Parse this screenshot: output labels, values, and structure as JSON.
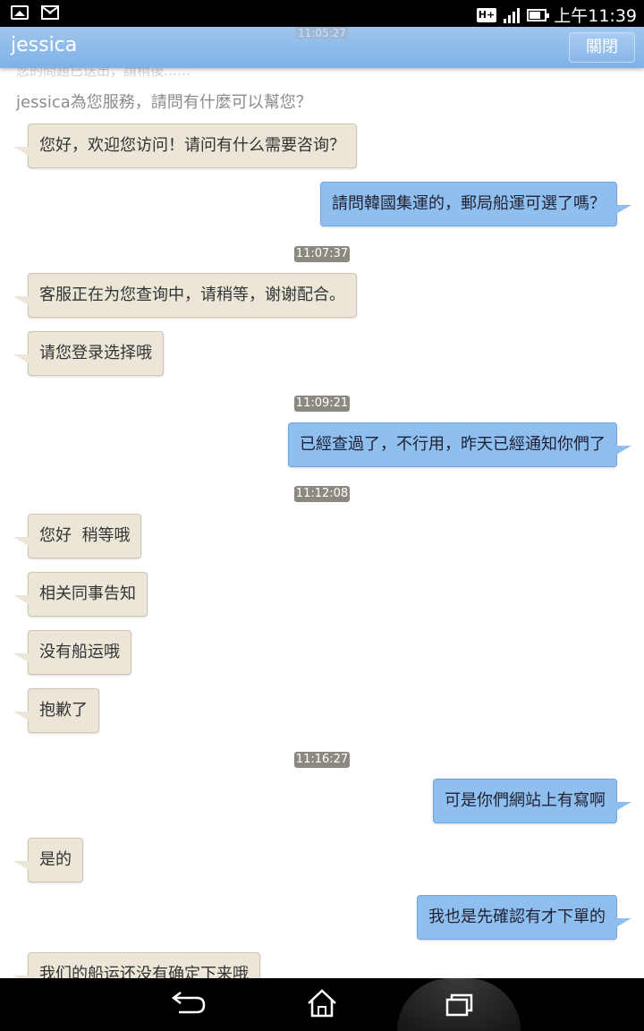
{
  "status_bar": {
    "time": "上午11:39",
    "icons": [
      "image-notification-icon",
      "mail-icon",
      "hplus-network-icon",
      "signal-icon",
      "battery-icon"
    ],
    "network_label": "H+"
  },
  "header": {
    "title": "jessica",
    "close_label": "關閉",
    "peek_time": "11:05:27",
    "color": "#8ab8ea"
  },
  "chat": {
    "peek_text": "您的問題已送出，請稍後……",
    "welcome": "jessica為您服務，請問有什麼可以幫您？",
    "messages": [
      {
        "side": "left",
        "text": "您好，欢迎您访问！请问有什么需要咨询？"
      },
      {
        "side": "right",
        "text": "請問韓國集運的，郵局船運可選了嗎？"
      },
      {
        "type": "time",
        "text": "11:07:37"
      },
      {
        "side": "left",
        "text": "客服正在为您查询中，请稍等，谢谢配合。"
      },
      {
        "side": "left",
        "text": "请您登录选择哦"
      },
      {
        "type": "time",
        "text": "11:09:21"
      },
      {
        "side": "right",
        "text": "已經查過了，不行用，昨天已經通知你們了"
      },
      {
        "type": "time",
        "text": "11:12:08"
      },
      {
        "side": "left",
        "text": "您好  稍等哦"
      },
      {
        "side": "left",
        "text": "相关同事告知"
      },
      {
        "side": "left",
        "text": "没有船运哦"
      },
      {
        "side": "left",
        "text": "抱歉了"
      },
      {
        "type": "time",
        "text": "11:16:27"
      },
      {
        "side": "right",
        "text": "可是你們網站上有寫啊"
      },
      {
        "side": "left",
        "text": "是的"
      },
      {
        "side": "right",
        "text": "我也是先確認有才下單的"
      },
      {
        "side": "left",
        "text": "我们的船运还没有确定下来哦"
      }
    ]
  },
  "nav_bar": {
    "buttons": [
      "back-icon",
      "home-icon",
      "recent-apps-icon"
    ]
  },
  "colors": {
    "left_bubble": "#ebe6d7",
    "right_bubble": "#8ebfef",
    "timestamp_bg": "#8c8a80"
  }
}
